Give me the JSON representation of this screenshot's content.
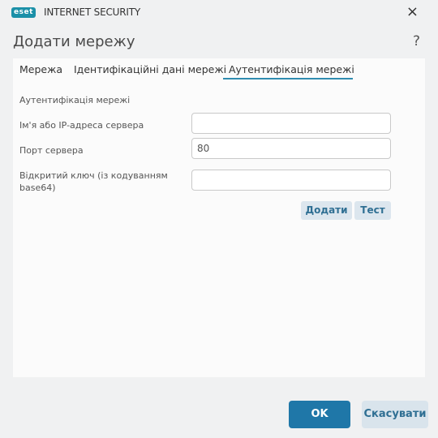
{
  "titlebar": {
    "logo": "eset",
    "product": "INTERNET SECURITY",
    "close_icon": "×"
  },
  "dialog": {
    "title": "Додати мережу",
    "help_icon": "?"
  },
  "tabs": [
    {
      "label": "Мережа",
      "active": false
    },
    {
      "label": "Ідентифікаційні дані мережі",
      "active": false
    },
    {
      "label": "Аутентифікація мережі",
      "active": true
    }
  ],
  "form": {
    "section_title": "Аутентифікація мережі",
    "server_label": "Ім'я або IP-адреса сервера",
    "server_value": "",
    "port_label": "Порт сервера",
    "port_value": "80",
    "key_label": "Відкритий ключ (із кодуванням base64)",
    "key_value": "",
    "add_button": "Додати",
    "test_button": "Тест"
  },
  "footer": {
    "ok_button": "OK",
    "cancel_button": "Скасувати"
  },
  "colors": {
    "accent": "#1f77a8",
    "logo": "#1b90a8",
    "secondary_button": "#d9e4ec"
  }
}
